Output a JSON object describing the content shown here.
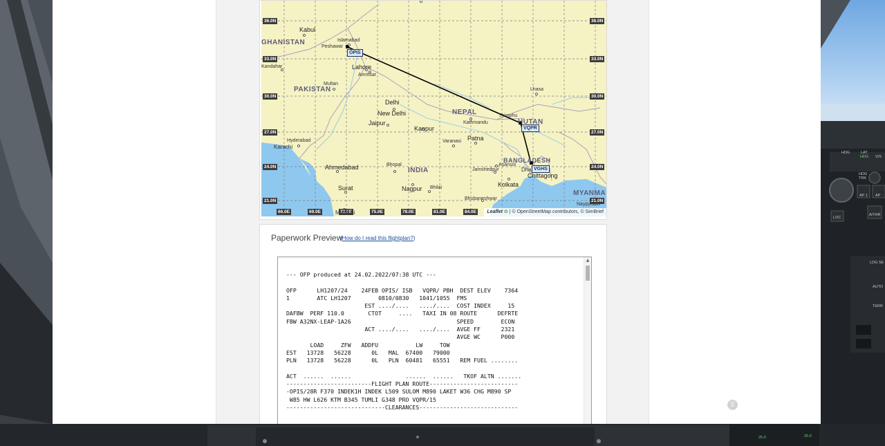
{
  "map": {
    "lat_labels": [
      "36.0N",
      "33.0N",
      "30.0N",
      "27.0N",
      "24.0N",
      "21.0N"
    ],
    "lon_labels": [
      "66.0E",
      "69.0E",
      "72.0E",
      "75.0E",
      "78.0E",
      "81.0E",
      "84.0E"
    ],
    "countries": [
      "GHANISTAN",
      "PAKISTAN",
      "NEPAL",
      "HUTAN",
      "BANGLADESH",
      "INDIA",
      "MYANMA"
    ],
    "cities": [
      "Kabul",
      "Islamabad",
      "Peshawar",
      "Lahore",
      "Amritsar",
      "Multan",
      "Kandahar",
      "Delhi",
      "New Delhi",
      "Jaipur",
      "Kanpur",
      "Kathmandu",
      "Thimphu",
      "Lhasa",
      "Patna",
      "Varanasi",
      "Hyderabad",
      "Karachi",
      "Ahmedabad",
      "Bhopal",
      "Asansol",
      "Jamshedpur",
      "Dhaka",
      "Chittagong",
      "Kolkata",
      "Surat",
      "Nagpur",
      "Bhilai",
      "Bhubaneshwar",
      "Mumbai",
      "Naypyidaw"
    ],
    "waypoints": [
      "OPIS",
      "VQPR",
      "VGHS"
    ],
    "attribution_leaflet": "Leaflet",
    "attribution_text": "| © OpenStreetMap contributors, © SimBrief"
  },
  "paperwork": {
    "title": "Paperwork Preview",
    "help_link": "How do I read this flightplan?",
    "ofp_text": "--- OFP produced at 24.02.2022/07:38 UTC ---\n\nOFP      LH1207/24    24FEB OPIS/ ISB   VQPR/ PBH  DEST ELEV    7364\n1        ATC LH1207        0810/0830   1041/1055  FMS\n                       EST ..../....   ..../....  COST INDEX     15\nDAFBW  PERF 110.0       CTOT     ....   TAXI IN 08 ROUTE      DEFRTE\nFBW A32NX-LEAP-1A26                               SPEED        ECON\n                       ACT ..../....   ..../....  AVGE FF      2321\n                                                  AVGE WC      P000\n       LOAD     ZFW   ADDFU           LW     TOW\nEST   13728   56228      0L   MAL  67400   79000\nPLN   13728   56228      0L   PLN  60481   65551   REM FUEL ........\n\nACT  ......  ......                ......  ......   TKOF ALTN .......\n-------------------------FLIGHT PLAN ROUTE--------------------------\n-OPIS/28R F370 INDEK1H INDEK L509 SULOM M890 LAKET W36 CHG M890 SP\n W85 HW L626 KTM B345 TUMLI G348 PRO VQPR/15\n-----------------------------CLEARANCES-----------------------------"
  },
  "cockpit": {
    "labels": [
      "HDG",
      "LAT",
      "HDG",
      "V/S",
      "HDG",
      "TRK",
      "AP 1",
      "AP",
      "LOC",
      "A/THR",
      "LDG SE",
      "AUTO",
      "TERR",
      "25.0",
      "25.0"
    ]
  },
  "colors": {
    "map_land": "#f5f2c4",
    "water": "#8fc8ef",
    "route": "#000000",
    "link": "#1a4fa3"
  }
}
